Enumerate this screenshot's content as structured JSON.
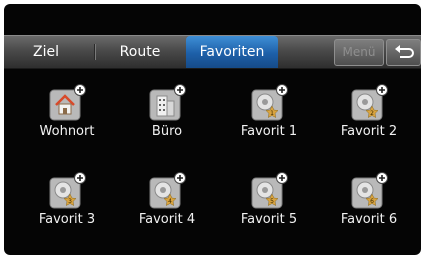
{
  "tabs": [
    {
      "label": "Ziel",
      "active": false
    },
    {
      "label": "Route",
      "active": false
    },
    {
      "label": "Favoriten",
      "active": true
    }
  ],
  "toolbar": {
    "menu_label": "Menü",
    "back_icon": "back-arrow-icon"
  },
  "favorites": [
    {
      "label": "Wohnort",
      "icon": "home-icon"
    },
    {
      "label": "Büro",
      "icon": "office-building-icon"
    },
    {
      "label": "Favorit 1",
      "icon": "favorite-pin-icon",
      "number": "1"
    },
    {
      "label": "Favorit 2",
      "icon": "favorite-pin-icon",
      "number": "2"
    },
    {
      "label": "Favorit 3",
      "icon": "favorite-pin-icon",
      "number": "3"
    },
    {
      "label": "Favorit 4",
      "icon": "favorite-pin-icon",
      "number": "4"
    },
    {
      "label": "Favorit 5",
      "icon": "favorite-pin-icon",
      "number": "5"
    },
    {
      "label": "Favorit 6",
      "icon": "favorite-pin-icon",
      "number": "6"
    }
  ],
  "colors": {
    "active_tab": "#2a74c4",
    "background": "#050505",
    "tabbar": "#4a4a4a",
    "star": "#d9a441"
  }
}
